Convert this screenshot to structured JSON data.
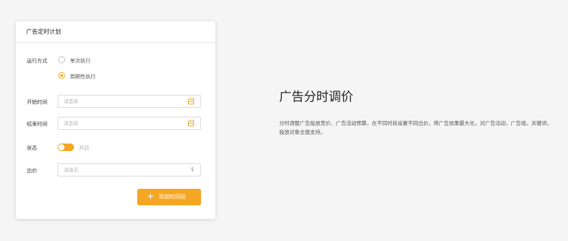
{
  "card": {
    "title": "广告定时计划",
    "run_mode": {
      "label": "运行方式",
      "options": [
        "单次执行",
        "周期性执行"
      ],
      "selected": "周期性执行"
    },
    "start_time": {
      "label": "开始时间",
      "placeholder": "请选择"
    },
    "end_time": {
      "label": "结束时间",
      "placeholder": "请选择"
    },
    "status": {
      "label": "状态",
      "toggle_text": "开启",
      "on": true
    },
    "bid": {
      "label": "出价",
      "placeholder": "请填写",
      "suffix": "$"
    },
    "add_button": {
      "icon": "+",
      "label": "添加时间段"
    }
  },
  "feature": {
    "title": "广告分时调价",
    "description": "分时调整广告投放竞价、广告活动预算，在不同时段设置不同出价，将广告效果最大化，对广告活动，广告组，关键词，投放对象全面支持。"
  },
  "colors": {
    "accent": "#f5a623"
  }
}
